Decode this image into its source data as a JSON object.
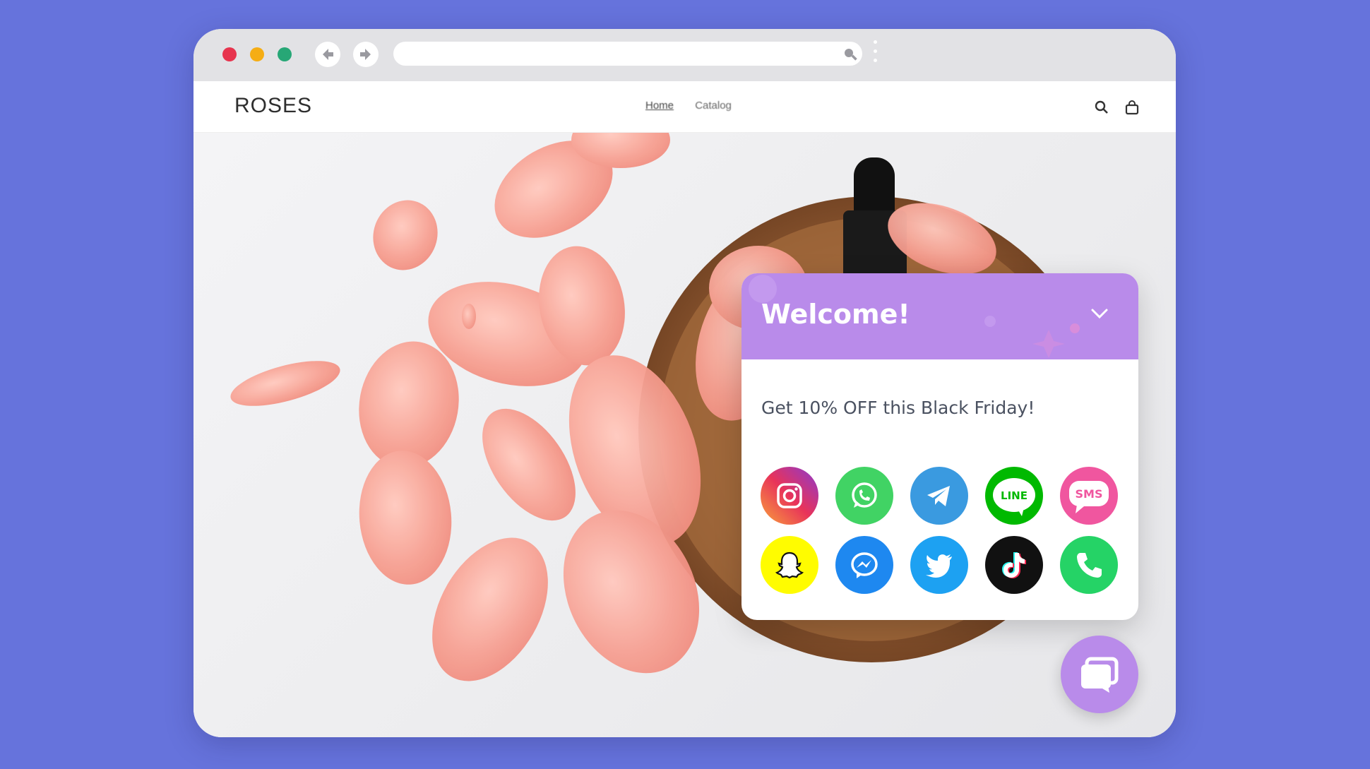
{
  "browser": {
    "url_value": ""
  },
  "site": {
    "logo": "ROSES",
    "nav": [
      {
        "label": "Home"
      },
      {
        "label": "Catalog"
      }
    ]
  },
  "widget": {
    "title": "Welcome!",
    "message": "Get 10% OFF this Black Friday!",
    "channels": [
      {
        "name": "instagram-icon"
      },
      {
        "name": "whatsapp-icon"
      },
      {
        "name": "telegram-icon"
      },
      {
        "name": "line-icon",
        "text": "LINE"
      },
      {
        "name": "sms-icon",
        "text": "SMS"
      },
      {
        "name": "snapchat-icon"
      },
      {
        "name": "messenger-icon"
      },
      {
        "name": "twitter-icon"
      },
      {
        "name": "tiktok-icon"
      },
      {
        "name": "phone-icon"
      }
    ]
  },
  "colors": {
    "background": "#6673dc",
    "accent": "#b98bea",
    "instagram": "#d6249f",
    "whatsapp": "#41d364",
    "telegram": "#3a9ae0",
    "line": "#00b900",
    "sms": "#f0569f",
    "snapchat": "#fffc00",
    "messenger": "#1e88f0",
    "twitter": "#1da1f2",
    "tiktok": "#111111",
    "phone": "#25d366"
  }
}
